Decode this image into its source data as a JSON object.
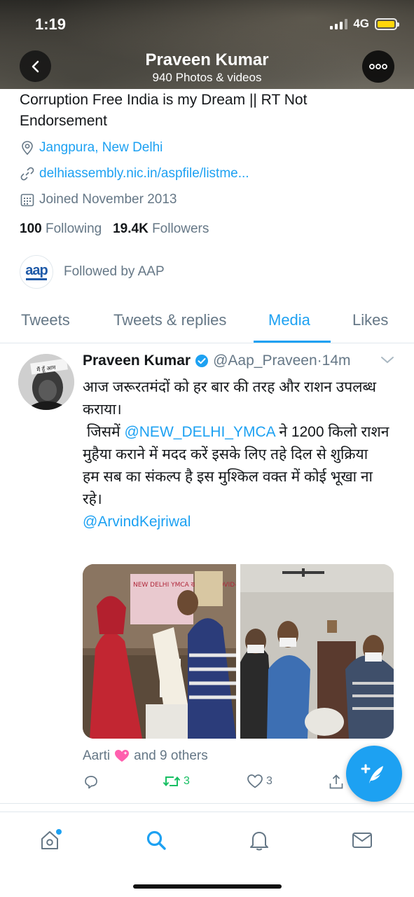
{
  "status_bar": {
    "time": "1:19",
    "network": "4G"
  },
  "header": {
    "name": "Praveen Kumar",
    "subtitle": "940 Photos & videos"
  },
  "profile": {
    "bio": "Corruption Free India is my Dream || RT Not Endorsement",
    "location": "Jangpura, New Delhi",
    "website": "delhiassembly.nic.in/aspfile/listme...",
    "joined": "Joined November 2013",
    "following_count": "100",
    "following_label": "Following",
    "followers_count": "19.4K",
    "followers_label": "Followers",
    "followed_by": "Followed by AAP",
    "followed_by_logo_text": "aap"
  },
  "tabs": [
    {
      "label": "Tweets"
    },
    {
      "label": "Tweets & replies"
    },
    {
      "label": "Media",
      "active": true
    },
    {
      "label": "Likes"
    }
  ],
  "tweet": {
    "name": "Praveen Kumar",
    "handle": "@Aap_Praveen",
    "separator": "·",
    "time": "14m",
    "line1": "आज जरूरतमंदों को हर बार की तरह और राशन उपलब्ध कराया।",
    "line2_prefix": " जिसमें ",
    "line2_mention": "@NEW_DELHI_YMCA",
    "line2_suffix": " ने 1200 किलो राशन मुहैया कराने में मदद करें इसके लिए तहे दिल से शुक्रिया",
    "line3": "हम सब का संकल्प है इस मुश्किल वक्त में कोई भूखा ना रहे।",
    "mention2": "@ArvindKejriwal",
    "photo1_sign": "NEW DELHI YMCA खाद्य वित COVID-19",
    "liked_by": "Aarti",
    "liked_by_rest": "and 9 others",
    "retweets": "3",
    "likes": "3"
  },
  "colors": {
    "accent": "#1da1f2",
    "retweet": "#17bf63",
    "muted": "#657786"
  },
  "icons": [
    "back-icon",
    "more-icon",
    "location-icon",
    "link-icon",
    "calendar-icon",
    "verified-icon",
    "reply-icon",
    "retweet-icon",
    "like-icon",
    "share-icon",
    "compose-icon",
    "home-icon",
    "search-icon",
    "notifications-icon",
    "messages-icon"
  ]
}
